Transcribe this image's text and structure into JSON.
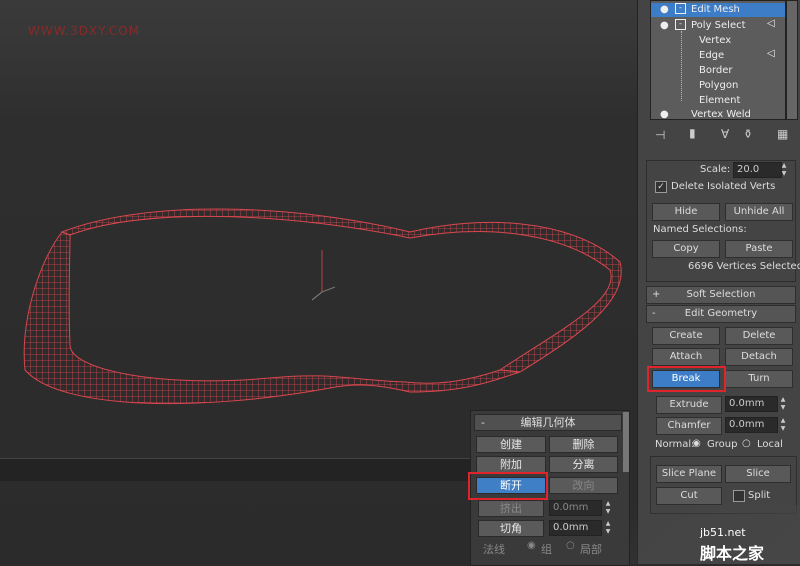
{
  "watermark": "WWW.3DXY.COM",
  "modifier_stack": {
    "items": [
      {
        "label": "Edit Mesh",
        "selected": true
      },
      {
        "label": "Poly Select"
      },
      {
        "label": "Vertex"
      },
      {
        "label": "Edge"
      },
      {
        "label": "Border"
      },
      {
        "label": "Polygon"
      },
      {
        "label": "Element"
      },
      {
        "label": "Vertex Weld"
      }
    ]
  },
  "selection": {
    "scale_label": "Scale:",
    "scale_value": "20.0",
    "delete_isolated": "Delete Isolated Verts",
    "hide": "Hide",
    "unhide_all": "Unhide All",
    "named_selections": "Named Selections:",
    "copy": "Copy",
    "paste": "Paste",
    "status": "6696 Vertices Selected"
  },
  "rollouts": {
    "soft_selection": "Soft Selection",
    "edit_geometry": "Edit Geometry",
    "plus": "+",
    "minus": "-"
  },
  "edit_geometry": {
    "create": "Create",
    "delete": "Delete",
    "attach": "Attach",
    "detach": "Detach",
    "break": "Break",
    "turn": "Turn",
    "extrude": "Extrude",
    "extrude_value": "0.0mm",
    "chamfer": "Chamfer",
    "chamfer_value": "0.0mm",
    "normal_label": "Normal:",
    "group": "Group",
    "local": "Local",
    "slice_plane": "Slice Plane",
    "slice": "Slice",
    "cut": "Cut",
    "split": "Split"
  },
  "cn_panel": {
    "rollout_title": "编辑几何体",
    "create": "创建",
    "delete": "删除",
    "attach": "附加",
    "detach": "分离",
    "break": "断开",
    "turn": "改向",
    "extrude": "挤出",
    "extrude_value": "0.0mm",
    "chamfer": "切角",
    "chamfer_value": "0.0mm",
    "normal_label": "法线",
    "group": "组",
    "local": "局部"
  },
  "site_watermark": {
    "url": "jb51.net",
    "name": "脚本之家"
  },
  "colors": {
    "accent": "#3d7dc7",
    "highlight_box": "#e0242c",
    "mesh": "#d9474f"
  }
}
